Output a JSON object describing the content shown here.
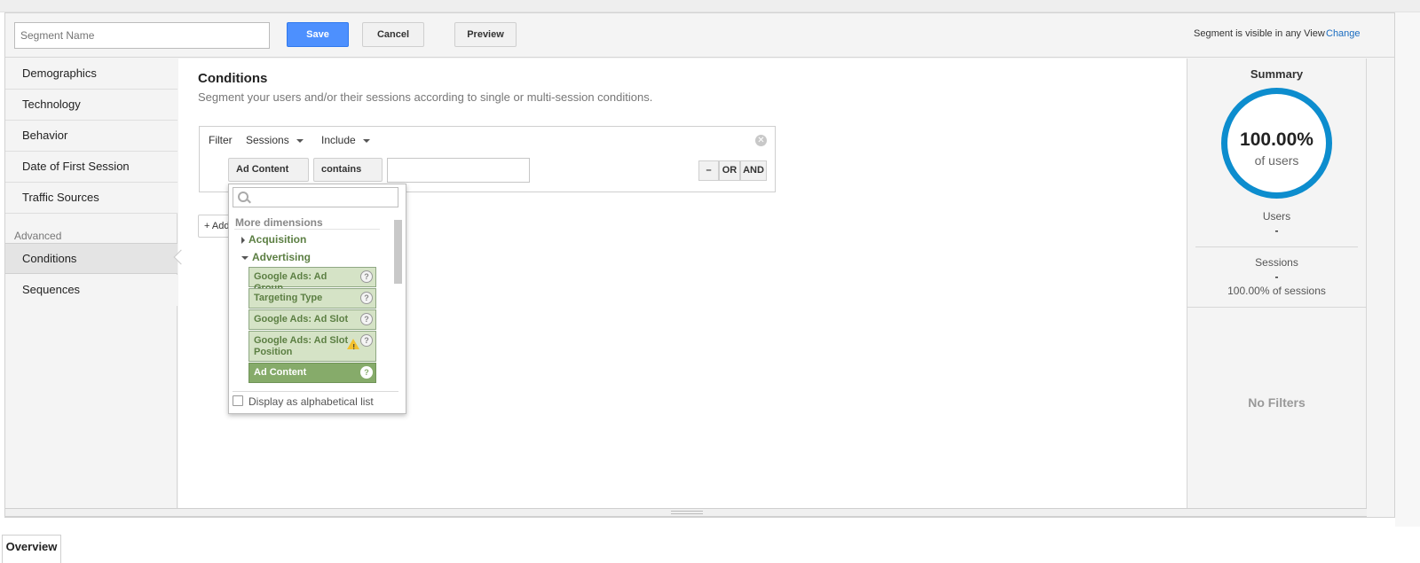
{
  "toolbar": {
    "segment_name_placeholder": "Segment Name",
    "save_label": "Save",
    "cancel_label": "Cancel",
    "preview_label": "Preview",
    "visibility_text": "Segment is visible in any View",
    "change_link": "Change"
  },
  "sidebar": {
    "items": [
      "Demographics",
      "Technology",
      "Behavior",
      "Date of First Session",
      "Traffic Sources"
    ],
    "advanced_label": "Advanced",
    "advanced_items": [
      "Conditions",
      "Sequences"
    ],
    "active_item": "Conditions"
  },
  "conditions": {
    "title": "Conditions",
    "subtitle": "Segment your users and/or their sessions according to single or multi-session conditions.",
    "filter_label": "Filter",
    "scope": "Sessions",
    "mode": "Include",
    "dimension": "Ad Content",
    "operator": "contains",
    "value": "",
    "logic_buttons": [
      "–",
      "OR",
      "AND"
    ],
    "add_filter_label": "+ Add Filter"
  },
  "dimension_dropdown": {
    "search_placeholder": "",
    "section_label": "More dimensions",
    "categories": [
      {
        "label": "Acquisition",
        "expanded": false
      },
      {
        "label": "Advertising",
        "expanded": true
      }
    ],
    "options": [
      "Google Ads: Ad Group",
      "Targeting Type",
      "Google Ads: Ad Slot",
      "Google Ads: Ad Slot Position",
      "Ad Content"
    ],
    "selected_option": "Ad Content",
    "alphabetical_label": "Display as alphabetical list",
    "alphabetical_checked": false
  },
  "summary": {
    "title": "Summary",
    "percent": "100.00%",
    "percent_of": "of users",
    "users_label": "Users",
    "users_value": "-",
    "sessions_label": "Sessions",
    "sessions_value": "-",
    "sessions_pct": "100.00% of sessions",
    "no_filters": "No Filters"
  },
  "bottom": {
    "overview_tab": "Overview"
  },
  "colors": {
    "save_button": "#4d90fe",
    "ring": "#0d8dce",
    "dimension_option": "#d5e3c6",
    "dimension_selected": "#86ab6a",
    "link": "#1a6cc0"
  }
}
